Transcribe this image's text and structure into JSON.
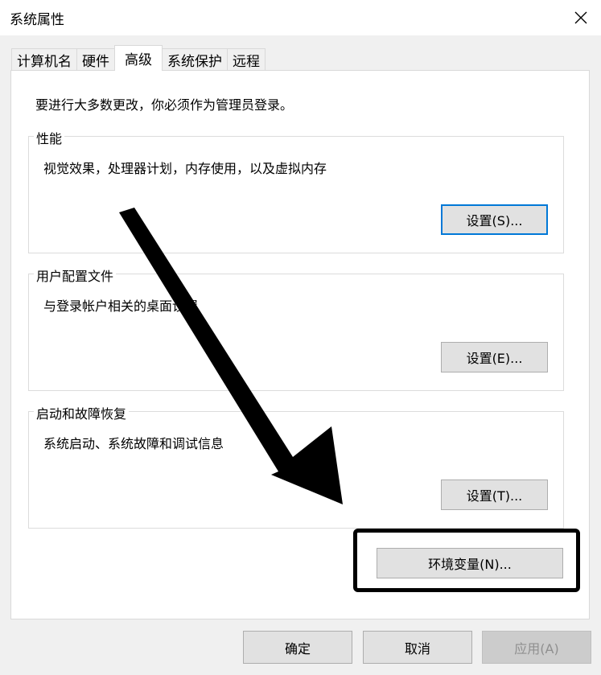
{
  "window": {
    "title": "系统属性"
  },
  "tabs": [
    {
      "label": "计算机名",
      "active": false
    },
    {
      "label": "硬件",
      "active": false
    },
    {
      "label": "高级",
      "active": true
    },
    {
      "label": "系统保护",
      "active": false
    },
    {
      "label": "远程",
      "active": false
    }
  ],
  "advanced": {
    "admin_note": "要进行大多数更改，你必须作为管理员登录。",
    "performance": {
      "title": "性能",
      "description": "视觉效果，处理器计划，内存使用，以及虚拟内存",
      "settings_label": "设置(S)..."
    },
    "user_profiles": {
      "title": "用户配置文件",
      "description": "与登录帐户相关的桌面设置",
      "settings_label": "设置(E)..."
    },
    "startup_recovery": {
      "title": "启动和故障恢复",
      "description": "系统启动、系统故障和调试信息",
      "settings_label": "设置(T)..."
    },
    "env_vars_label": "环境变量(N)..."
  },
  "footer": {
    "ok_label": "确定",
    "cancel_label": "取消",
    "apply_label": "应用(A)"
  },
  "colors": {
    "focus_border": "#0078d7",
    "annotation": "#000000",
    "disabled_text": "#8f8f8f"
  },
  "icons": {
    "close": "close-icon",
    "annotation_arrow": "arrow-annotation"
  }
}
